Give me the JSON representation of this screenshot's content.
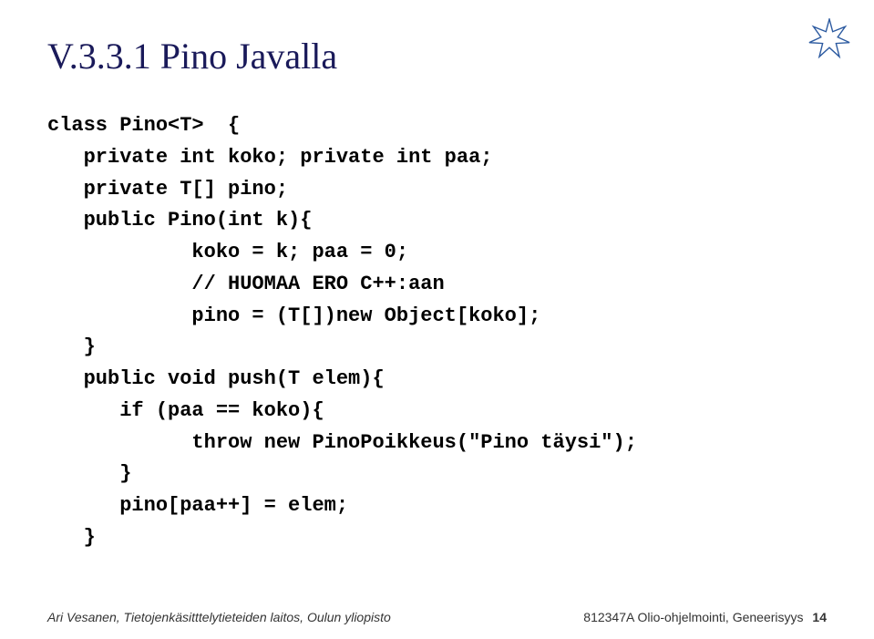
{
  "title": "V.3.3.1 Pino Javalla",
  "code": {
    "l1": "class Pino<T>  {",
    "l2": "   private int koko; private int paa;",
    "l3": "   private T[] pino;",
    "l4": "   public Pino(int k){",
    "l5": "            koko = k; paa = 0;",
    "l6": "            // HUOMAA ERO C++:aan",
    "l7": "            pino = (T[])new Object[koko];",
    "l8": "   }",
    "l9": "   public void push(T elem){",
    "l10": "      if (paa == koko){",
    "l11": "            throw new PinoPoikkeus(\"Pino täysi\");",
    "l12": "      }",
    "l13": "      pino[paa++] = elem;",
    "l14": "   }"
  },
  "footer": {
    "left": "Ari Vesanen, Tietojenkäsitttelytieteiden laitos, Oulun yliopisto",
    "right_text": "812347A Olio-ohjelmointi, Geneerisyys",
    "page": "14"
  },
  "colors": {
    "title": "#1a1a5a",
    "star_fill": "#ffffff",
    "star_stroke": "#2c5aa0"
  }
}
